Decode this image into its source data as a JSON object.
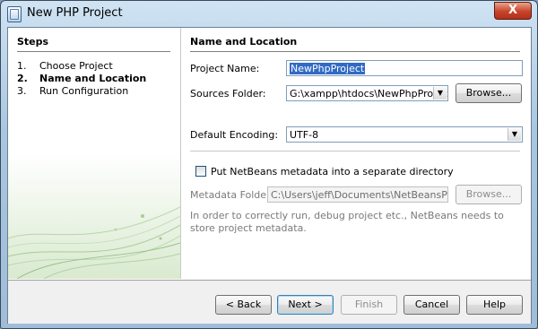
{
  "window": {
    "title": "New PHP Project",
    "close_label": "X"
  },
  "steps": {
    "heading": "Steps",
    "items": [
      {
        "num": "1.",
        "label": "Choose Project"
      },
      {
        "num": "2.",
        "label": "Name and Location"
      },
      {
        "num": "3.",
        "label": "Run Configuration"
      }
    ]
  },
  "main": {
    "heading": "Name and Location",
    "project_name": {
      "label": "Project Name:",
      "value": "NewPhpProject"
    },
    "sources_folder": {
      "label": "Sources Folder:",
      "value": "G:\\xampp\\htdocs\\NewPhpProject",
      "browse_label": "Browse..."
    },
    "default_encoding": {
      "label": "Default Encoding:",
      "value": "UTF-8"
    },
    "netbeans_metadata": {
      "label": "Put NetBeans metadata into a separate directory",
      "checked": false
    },
    "metadata_folder": {
      "label": "Metadata Folder:",
      "value": "C:\\Users\\jeff\\Documents\\NetBeansProject",
      "browse_label": "Browse..."
    },
    "help_text": "In order to correctly run, debug project etc., NetBeans needs to store project metadata."
  },
  "footer": {
    "back_label": "< Back",
    "next_label": "Next >",
    "finish_label": "Finish",
    "cancel_label": "Cancel",
    "help_label": "Help"
  }
}
